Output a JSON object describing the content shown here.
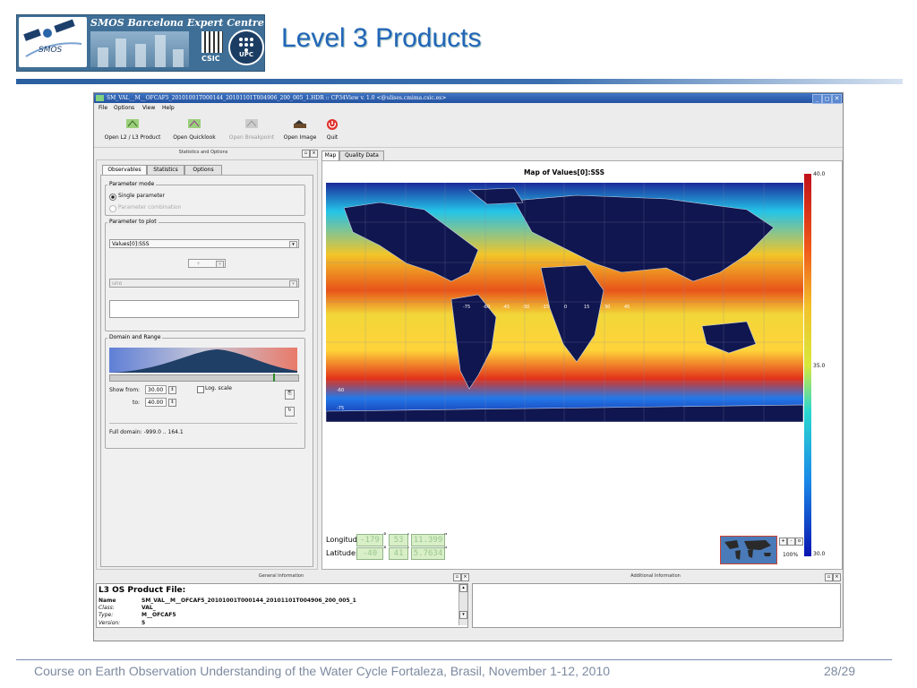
{
  "slide": {
    "logo_title": "SMOS Barcelona Expert Centre",
    "logo_smos": "SMOS",
    "logo_csic": "CSIC",
    "logo_upc": "UPC",
    "title": "Level 3 Products",
    "footer": "Course on Earth Observation Understanding of the Water Cycle Fortaleza, Brasil, November 1-12, 2010",
    "page": "28/29"
  },
  "window": {
    "title": "SM_VAL__M__OFCAF5_20101001T000144_20101101T004906_200_005_1.HDR :: CP34View v. 1.0 <@ulises.cmima.csic.es>",
    "menu": [
      "File",
      "Options",
      "View",
      "Help"
    ]
  },
  "toolbar": {
    "open_l2l3": "Open L2 / L3 Product",
    "open_quicklook": "Open Quicklook",
    "open_breakpoint": "Open Breakpoint",
    "open_image": "Open Image",
    "quit": "Quit"
  },
  "left_panel": {
    "header": "Statistics and Options",
    "tabs": [
      "Observables",
      "Statistics",
      "Options"
    ],
    "param_mode_label": "Parameter mode",
    "single_param": "Single parameter",
    "param_combination": "Parameter combination",
    "param_to_plot_label": "Parameter to plot",
    "param_selected": "Values[0]:SSS",
    "operator": "+",
    "second_param": "uno",
    "domain_range_label": "Domain and Range",
    "show_from_label": "Show from:",
    "show_from_value": "30.00",
    "to_label": "to:",
    "to_value": "40.00",
    "log_scale": "Log. scale",
    "full_domain": "Full domain: -999.0 .. 164.1"
  },
  "map_panel": {
    "tabs": [
      "Map",
      "Quality Data"
    ],
    "map_title": "Map of Values[0]:SSS",
    "colorbar_max": "40.0",
    "colorbar_mid": "35.0",
    "colorbar_min": "30.0",
    "lon_labels": [
      "-75",
      "-60",
      "-45",
      "-30",
      "-15",
      "0",
      "15",
      "30",
      "45"
    ],
    "lat_labels": [
      "-60",
      "-75"
    ],
    "longitude_label": "Longitud",
    "latitude_label": "Latitude:",
    "lon_deg": "-179",
    "lon_min": "53",
    "lon_sec": "11.399",
    "lat_deg": "-40",
    "lat_min": "41",
    "lat_sec": "5.7634",
    "zoom": "100%"
  },
  "bottom": {
    "general_header": "General Information",
    "additional_header": "Additional Information",
    "file_heading": "L3 OS Product File:",
    "rows": [
      {
        "k": "Name",
        "v": "SM_VAL__M__OFCAF5_20101001T000144_20101101T004906_200_005_1"
      },
      {
        "k": "Class:",
        "v": "VAL_"
      },
      {
        "k": "Type:",
        "v": "M__OFCAF5"
      },
      {
        "k": "Version:",
        "v": "5"
      }
    ]
  },
  "colors": {
    "title_blue": "#2266b8",
    "window_blue": "#2a5aa8"
  }
}
